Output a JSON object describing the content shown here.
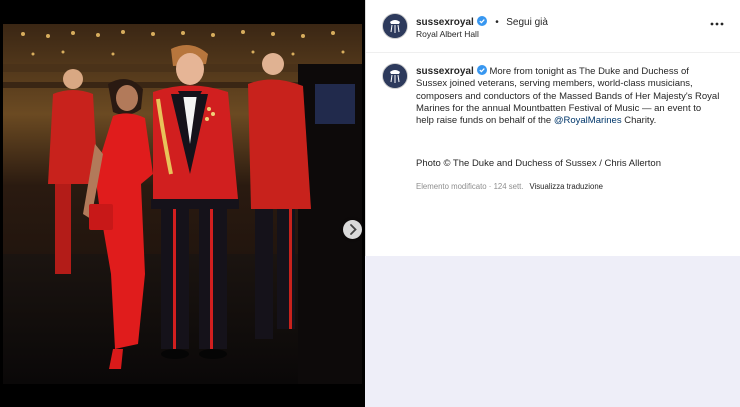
{
  "post": {
    "username": "sussexroyal",
    "follow_separator": "•",
    "follow_label": "Segui già",
    "location": "Royal Albert Hall",
    "more_icon": "more-horizontal-icon",
    "caption_username": "sussexroyal",
    "caption_text_1": "More from tonight as The Duke and Duchess of Sussex joined veterans, serving members, world-class musicians, composers and conductors of the Massed Bands of Her Majesty's Royal Marines for the annual Mountbatten Festival of Music — an event to help raise funds on behalf of the ",
    "caption_mention": "@RoyalMarines",
    "caption_text_2": " Charity.",
    "photo_credit": "Photo © The Duke and Duchess of Sussex / Chris Allerton",
    "edited_label": "Elemento modificato · 124 sett.",
    "translate_label": "Visualizza traduzione"
  },
  "carousel": {
    "next_icon": "chevron-right-icon",
    "slide_count": 3,
    "active_slide": 1
  },
  "colors": {
    "verified_blue": "#3897f0",
    "link_blue": "#00376b",
    "active_dot": "#3d9bea",
    "lower_panel": "#eeeef8"
  }
}
